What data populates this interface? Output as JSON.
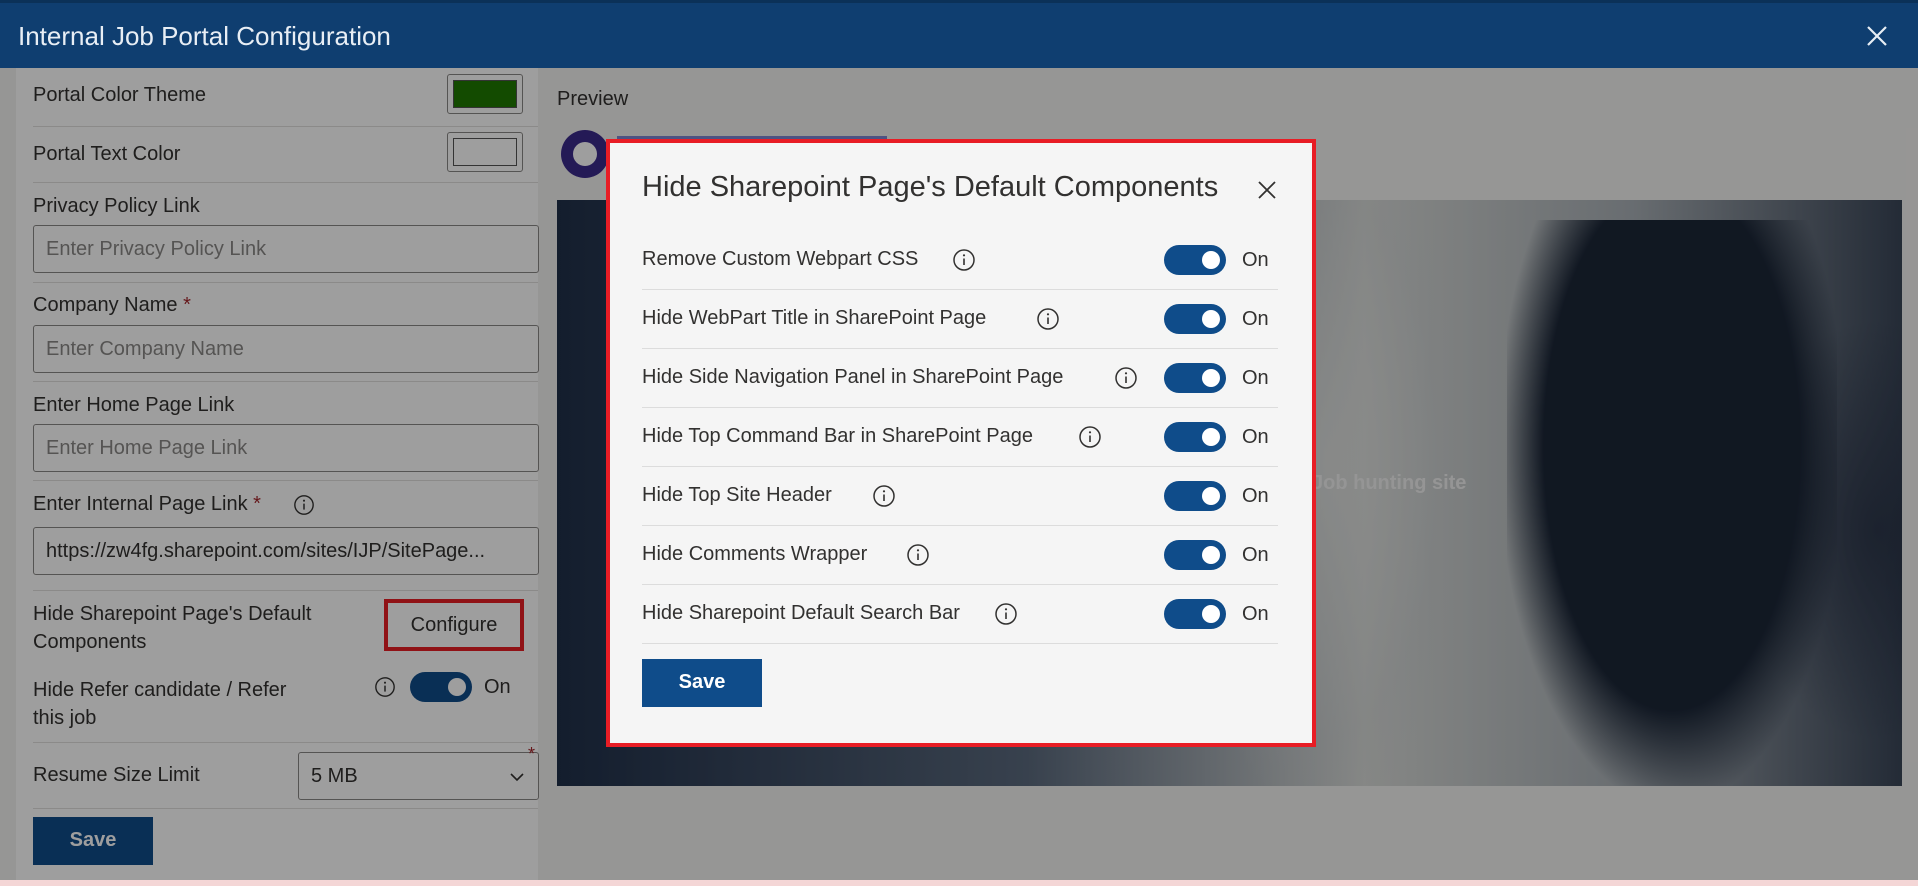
{
  "window": {
    "title": "Internal Job Portal Configuration"
  },
  "form": {
    "portal_color_theme": {
      "label": "Portal Color Theme",
      "value": "#1f7a00"
    },
    "portal_text_color": {
      "label": "Portal Text Color",
      "value": "#ffffff"
    },
    "privacy_policy": {
      "label": "Privacy Policy Link",
      "placeholder": "Enter Privacy Policy Link"
    },
    "company_name": {
      "label": "Company Name",
      "required": "*",
      "placeholder": "Enter Company Name"
    },
    "home_page": {
      "label": "Enter Home Page Link",
      "placeholder": "Enter Home Page Link"
    },
    "internal_page": {
      "label": "Enter Internal Page Link",
      "required": "*",
      "value": "https://zw4fg.sharepoint.com/sites/IJP/SitePage..."
    },
    "hide_default": {
      "label": "Hide Sharepoint Page's Default Components",
      "button": "Configure"
    },
    "hide_refer": {
      "label": "Hide Refer candidate / Refer this job",
      "state": "On"
    },
    "resume_limit": {
      "label": "Resume Size Limit",
      "value": "5 MB",
      "required": "*"
    },
    "save": "Save"
  },
  "preview": {
    "label": "Preview",
    "tagline": "Job hunting site"
  },
  "modal": {
    "title": "Hide Sharepoint Page's Default Components",
    "items": [
      {
        "label": "Remove Custom Webpart CSS",
        "state": "On"
      },
      {
        "label": "Hide WebPart Title in SharePoint Page",
        "state": "On"
      },
      {
        "label": "Hide Side Navigation Panel in SharePoint Page",
        "state": "On"
      },
      {
        "label": "Hide Top Command Bar in SharePoint Page",
        "state": "On"
      },
      {
        "label": "Hide Top Site Header",
        "state": "On"
      },
      {
        "label": "Hide Comments Wrapper",
        "state": "On"
      },
      {
        "label": "Hide Sharepoint Default Search Bar",
        "state": "On"
      }
    ],
    "save": "Save"
  },
  "colors": {
    "accent": "#0f4c8a",
    "titlebar": "#0f3e70",
    "highlight": "#e81d25"
  },
  "icons": [
    "close-icon",
    "info-icon",
    "chevron-down-icon",
    "logo-icon"
  ]
}
